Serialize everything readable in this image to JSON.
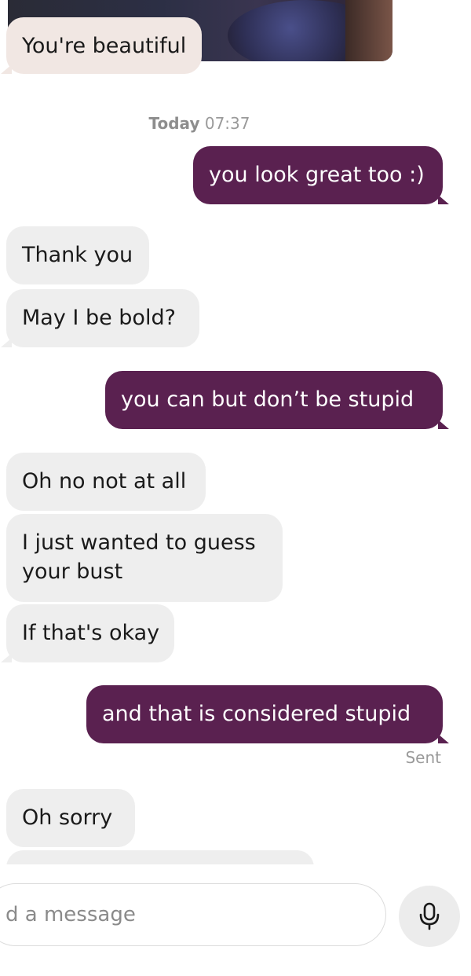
{
  "messages": [
    {
      "text": "You're beautiful"
    },
    {
      "text": "you look great too :)"
    },
    {
      "text": "Thank you"
    },
    {
      "text": "May I be bold?"
    },
    {
      "text": "you can but don’t be stupid"
    },
    {
      "text": "Oh no not at all"
    },
    {
      "text": "I just wanted to guess"
    },
    {
      "text": "your bust"
    },
    {
      "text": "If that's okay"
    },
    {
      "text": "and that is considered stupid"
    },
    {
      "text": "Oh sorry"
    }
  ],
  "timestamp": {
    "day": "Today",
    "time": "07:37"
  },
  "status": {
    "sent": "Sent"
  },
  "composer": {
    "placeholder": "d a message",
    "mic_icon": "microphone-icon"
  },
  "colors": {
    "outgoing": "#5a2150",
    "incoming": "#eeeeee",
    "incoming_first": "#f1e7e3"
  }
}
